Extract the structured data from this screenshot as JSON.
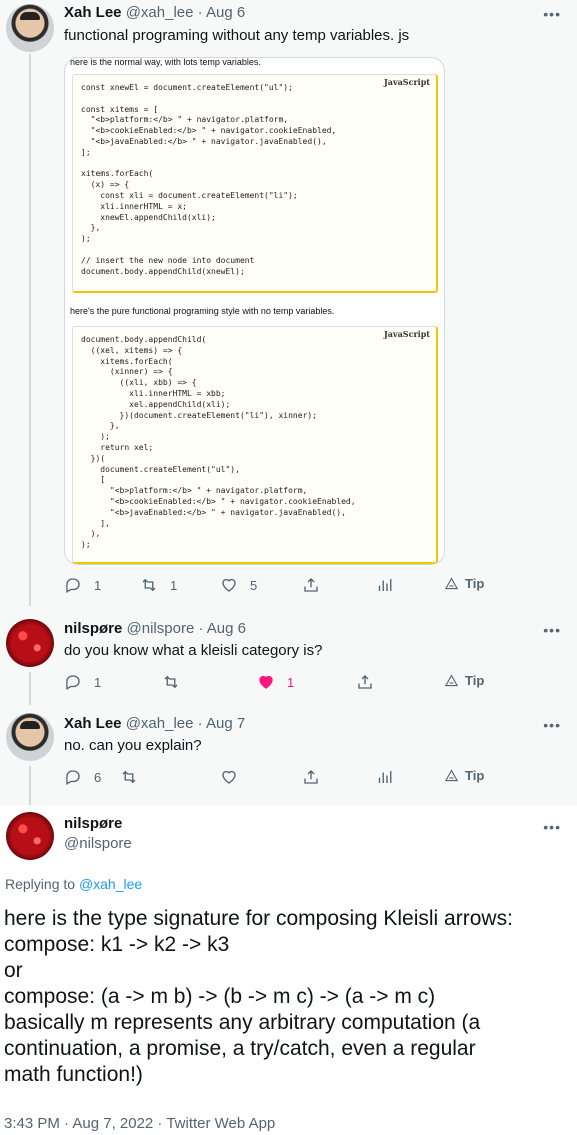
{
  "tweets": [
    {
      "name": "Xah Lee",
      "handle": "@xah_lee",
      "date": "· Aug 6",
      "text": "functional programing without any temp variables. js",
      "media": {
        "caption1": "here is the normal way, with lots temp variables.",
        "lang1": "JavaScript",
        "code1": "const xnewEl = document.createElement(\"ul\");\n\nconst xitems = [\n  \"<b>platform:</b> \" + navigator.platform,\n  \"<b>cookieEnabled:</b> \" + navigator.cookieEnabled,\n  \"<b>javaEnabled:</b> \" + navigator.javaEnabled(),\n];\n\nxitems.forEach(\n  (x) => {\n    const xli = document.createElement(\"li\");\n    xli.innerHTML = x;\n    xnewEl.appendChild(xli);\n  },\n);\n\n// insert the new node into document\ndocument.body.appendChild(xnewEl);",
        "caption2": "here's the pure functional programing style with no temp variables.",
        "lang2": "JavaScript",
        "code2": "document.body.appendChild(\n  ((xel, xitems) => {\n    xitems.forEach(\n      (xinner) => {\n        ((xli, xbb) => {\n          xli.innerHTML = xbb;\n          xel.appendChild(xli);\n        })(document.createElement(\"li\"), xinner);\n      },\n    );\n    return xel;\n  })(\n    document.createElement(\"ul\"),\n    [\n      \"<b>platform:</b> \" + navigator.platform,\n      \"<b>cookieEnabled:</b> \" + navigator.cookieEnabled,\n      \"<b>javaEnabled:</b> \" + navigator.javaEnabled(),\n    ],\n  ),\n);"
      },
      "replies": "1",
      "retweets": "1",
      "likes": "5",
      "tip": "Tip"
    },
    {
      "name": "nilspøre",
      "handle": "@nilspore",
      "date": "· Aug 6",
      "text": "do you know what a kleisli category is?",
      "replies": "1",
      "likes": "1",
      "tip": "Tip"
    },
    {
      "name": "Xah Lee",
      "handle": "@xah_lee",
      "date": "· Aug 7",
      "text": "no. can you explain?",
      "replies": "6",
      "tip": "Tip"
    }
  ],
  "main": {
    "name": "nilspøre",
    "handle": "@nilspore",
    "replying_prefix": "Replying to ",
    "replying_to": "@xah_lee",
    "text_lines": [
      "here is the type signature for composing Kleisli arrows:",
      "compose: k1 -> k2 -> k3",
      "or",
      "compose: (a -> m b) -> (b -> m c) -> (a -> m c)",
      "basically m represents any arbitrary computation (a",
      "continuation, a promise, a try/catch, even a regular",
      "math function!)"
    ],
    "timestamp": "3:43 PM · Aug 7, 2022 · Twitter Web App"
  },
  "icons": {
    "more": "more-icon",
    "reply": "reply-icon",
    "retweet": "retweet-icon",
    "like": "heart-icon",
    "share": "share-icon",
    "analytics": "analytics-icon",
    "tip": "tip-icon"
  },
  "colors": {
    "like_active": "#f91880",
    "link": "#1d9bf0",
    "thread_bg": "#f7f9f9"
  }
}
